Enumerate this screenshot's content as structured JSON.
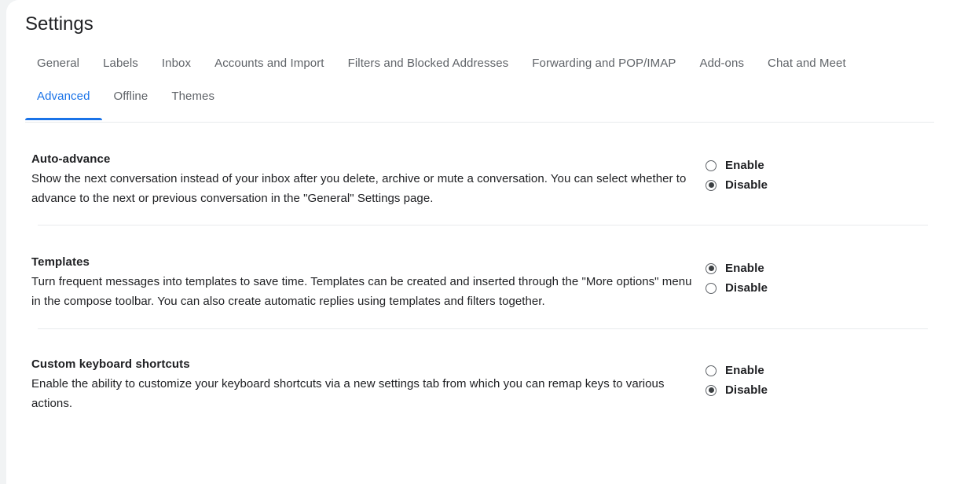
{
  "page": {
    "title": "Settings",
    "accent_color": "#1a73e8",
    "text_color": "#202124",
    "muted_text_color": "#5f6368",
    "divider_color": "#e8eaed",
    "background_color": "#f1f3f4",
    "card_color": "#ffffff"
  },
  "tabs": {
    "row1": [
      {
        "label": "General",
        "active": false
      },
      {
        "label": "Labels",
        "active": false
      },
      {
        "label": "Inbox",
        "active": false
      },
      {
        "label": "Accounts and Import",
        "active": false
      },
      {
        "label": "Filters and Blocked Addresses",
        "active": false
      },
      {
        "label": "Forwarding and POP/IMAP",
        "active": false
      },
      {
        "label": "Add-ons",
        "active": false
      },
      {
        "label": "Chat and Meet",
        "active": false
      }
    ],
    "row2": [
      {
        "label": "Advanced",
        "active": true
      },
      {
        "label": "Offline",
        "active": false
      },
      {
        "label": "Themes",
        "active": false
      }
    ]
  },
  "sections": [
    {
      "title": "Auto-advance",
      "description": "Show the next conversation instead of your inbox after you delete, archive or mute a conversation. You can select whether to advance to the next or previous conversation in the \"General\" Settings page.",
      "options": [
        {
          "label": "Enable",
          "selected": false
        },
        {
          "label": "Disable",
          "selected": true
        }
      ]
    },
    {
      "title": "Templates",
      "description": "Turn frequent messages into templates to save time. Templates can be created and inserted through the \"More options\" menu in the compose toolbar. You can also create automatic replies using templates and filters together.",
      "options": [
        {
          "label": "Enable",
          "selected": true
        },
        {
          "label": "Disable",
          "selected": false
        }
      ]
    },
    {
      "title": "Custom keyboard shortcuts",
      "description": "Enable the ability to customize your keyboard shortcuts via a new settings tab from which you can remap keys to various actions.",
      "options": [
        {
          "label": "Enable",
          "selected": false
        },
        {
          "label": "Disable",
          "selected": true
        }
      ]
    }
  ]
}
